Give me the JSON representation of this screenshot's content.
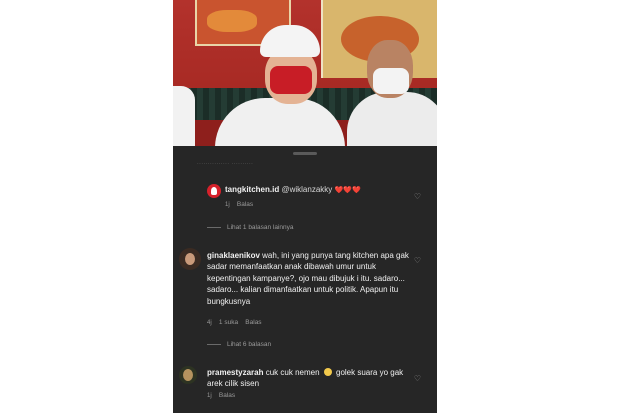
{
  "sheet": {
    "faded_top": "...............   ..........",
    "comments": [
      {
        "username": "tangkitchen.id",
        "mention": "@wiklanzakky",
        "text": "❤️❤️❤️",
        "age": "1j",
        "reply_label": "Balas",
        "view_replies": "Lihat 1 balasan lainnya"
      },
      {
        "username": "ginaklaenikov",
        "text": "wah, ini yang punya tang kitchen apa gak sadar memanfaatkan anak dibawah umur untuk kepentingan kampanye?, ojo mau dibujuk i itu. sadaro... sadaro... kalian dimanfaatkan untuk politik. Apapun itu bungkusnya",
        "age": "4j",
        "likes": "1 suka",
        "reply_label": "Balas",
        "view_replies": "Lihat 6 balasan"
      },
      {
        "username": "pramestyzarah",
        "text_before": "cuk cuk nemen",
        "text_after": "golek suara yo gak arek cilik sisen",
        "age": "1j",
        "reply_label": "Balas"
      }
    ]
  },
  "icons": {
    "like": "heart-outline-icon",
    "emoji": "grinning-face-icon"
  }
}
